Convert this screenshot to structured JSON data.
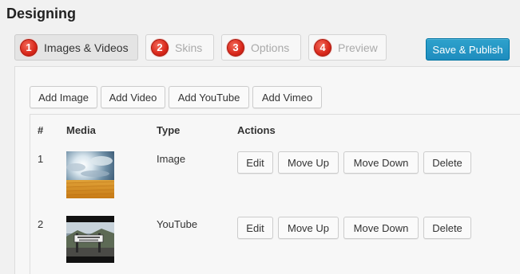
{
  "page": {
    "title": "Designing"
  },
  "steps": [
    {
      "num": "1",
      "label": "Images & Videos",
      "active": true
    },
    {
      "num": "2",
      "label": "Skins",
      "active": false
    },
    {
      "num": "3",
      "label": "Options",
      "active": false
    },
    {
      "num": "4",
      "label": "Preview",
      "active": false
    }
  ],
  "publish_label": "Save & Publish",
  "add_buttons": {
    "image": "Add Image",
    "video": "Add Video",
    "youtube": "Add YouTube",
    "vimeo": "Add Vimeo"
  },
  "table": {
    "headers": {
      "num": "#",
      "media": "Media",
      "type": "Type",
      "actions": "Actions"
    },
    "rows": [
      {
        "num": "1",
        "type": "Image",
        "thumb": "sky-over-desert-thumbnail"
      },
      {
        "num": "2",
        "type": "YouTube",
        "thumb": "street-sign-thumbnail"
      }
    ],
    "actions": {
      "edit": "Edit",
      "move_up": "Move Up",
      "move_down": "Move Down",
      "delete": "Delete"
    }
  },
  "colors": {
    "primary": "#1e8cbe",
    "step_badge": "#d8271a"
  }
}
